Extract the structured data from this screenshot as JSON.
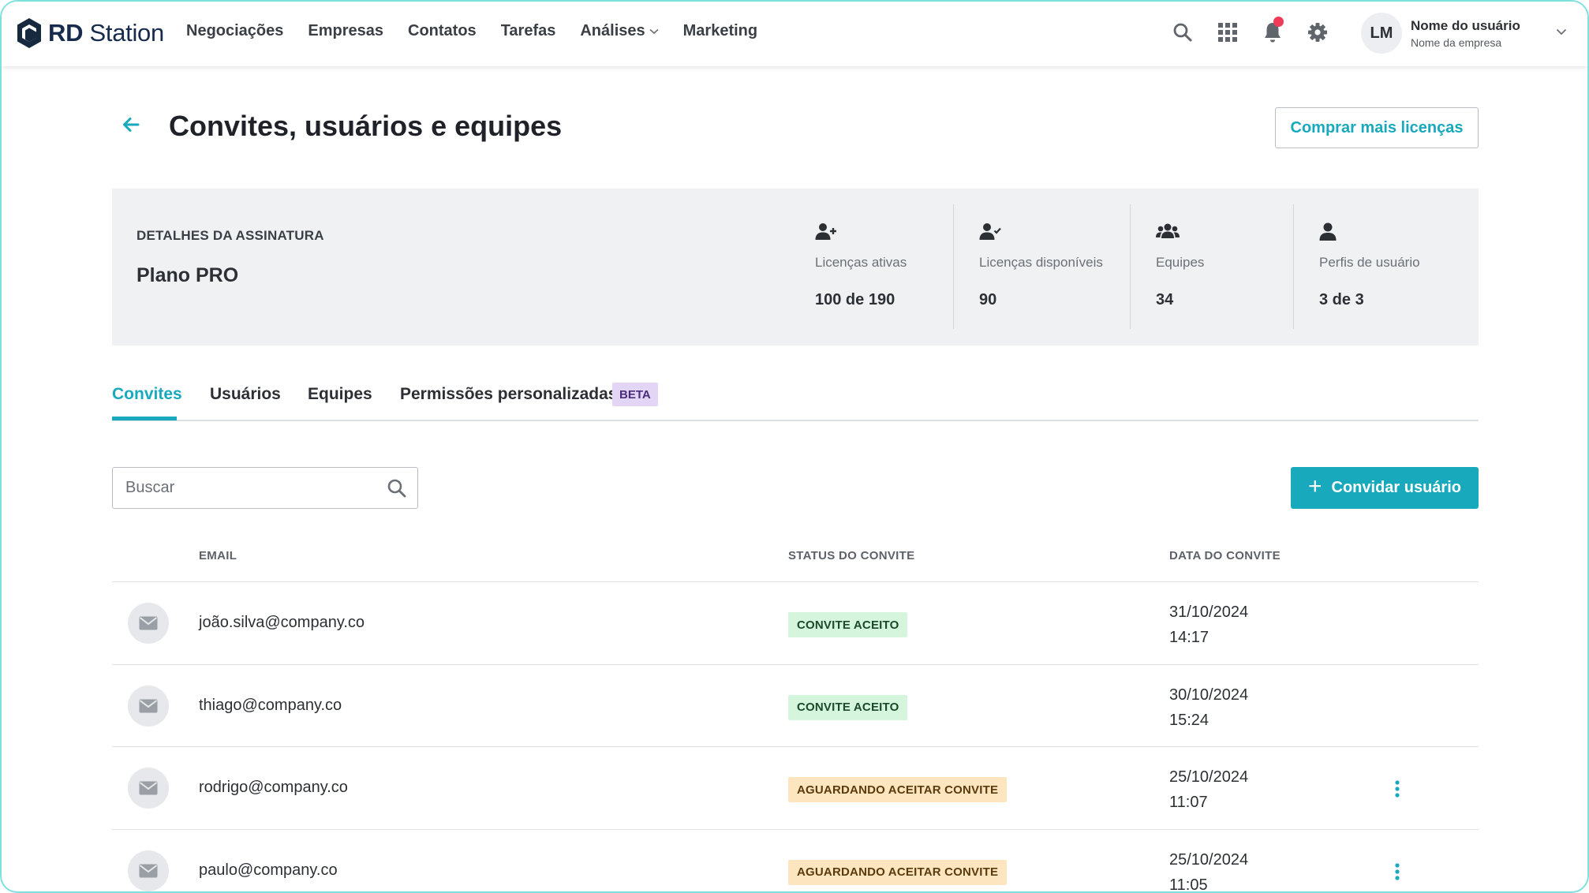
{
  "brand": {
    "strong": "RD",
    "rest": " Station"
  },
  "nav": {
    "items": [
      {
        "label": "Negociações",
        "dropdown": false
      },
      {
        "label": "Empresas",
        "dropdown": false
      },
      {
        "label": "Contatos",
        "dropdown": false
      },
      {
        "label": "Tarefas",
        "dropdown": false
      },
      {
        "label": "Análises",
        "dropdown": true
      },
      {
        "label": "Marketing",
        "dropdown": false
      }
    ],
    "icons": [
      "search-icon",
      "apps-grid-icon",
      "bell-icon",
      "gear-icon"
    ],
    "has_notification": true
  },
  "user": {
    "initials": "LM",
    "name": "Nome do usuário",
    "company": "Nome da empresa"
  },
  "page": {
    "title": "Convites, usuários e equipes",
    "buy_button": "Comprar mais licenças"
  },
  "subscription": {
    "label": "DETALHES DA ASSINATURA",
    "plan": "Plano PRO",
    "stats": [
      {
        "icon": "user-plus-icon",
        "label": "Licenças ativas",
        "value": "100 de 190"
      },
      {
        "icon": "user-check-icon",
        "label": "Licenças disponíveis",
        "value": "90"
      },
      {
        "icon": "users-icon",
        "label": "Equipes",
        "value": "34"
      },
      {
        "icon": "user-icon",
        "label": "Perfis de usuário",
        "value": "3 de 3"
      }
    ]
  },
  "tabs": [
    {
      "label": "Convites",
      "active": true
    },
    {
      "label": "Usuários",
      "active": false
    },
    {
      "label": "Equipes",
      "active": false
    },
    {
      "label": "Permissões personalizadas",
      "active": false,
      "badge": "BETA"
    }
  ],
  "search": {
    "placeholder": "Buscar",
    "value": ""
  },
  "invite_button": "Convidar usuário",
  "table": {
    "columns": [
      "EMAIL",
      "STATUS DO CONVITE",
      "DATA DO CONVITE"
    ],
    "rows": [
      {
        "email": "joão.silva@company.co",
        "status": "CONVITE ACEITO",
        "status_type": "accepted",
        "date": "31/10/2024",
        "time": "14:17",
        "has_menu": false
      },
      {
        "email": "thiago@company.co",
        "status": "CONVITE ACEITO",
        "status_type": "accepted",
        "date": "30/10/2024",
        "time": "15:24",
        "has_menu": false
      },
      {
        "email": "rodrigo@company.co",
        "status": "AGUARDANDO ACEITAR CONVITE",
        "status_type": "pending",
        "date": "25/10/2024",
        "time": "11:07",
        "has_menu": true
      },
      {
        "email": "paulo@company.co",
        "status": "AGUARDANDO ACEITAR CONVITE",
        "status_type": "pending",
        "date": "25/10/2024",
        "time": "11:05",
        "has_menu": true
      }
    ]
  },
  "colors": {
    "accent": "#19a9bd",
    "accepted_bg": "#d5f5dc",
    "pending_bg": "#fde5bf",
    "beta_bg": "#e3d5f5",
    "notification": "#ef3b57"
  }
}
